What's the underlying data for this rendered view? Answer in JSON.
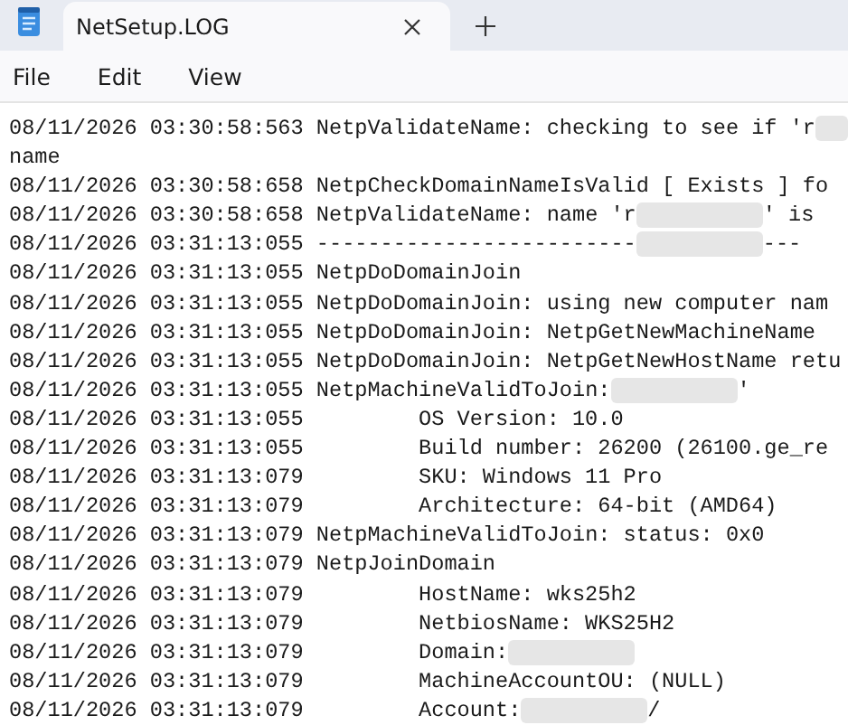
{
  "tabs": [
    {
      "label": "NetSetup.LOG",
      "selected": true
    }
  ],
  "menu": [
    "File",
    "Edit",
    "View"
  ],
  "lines": [
    {
      "kind": "entry",
      "timestamp": "08/11/2026 03:30:58:563",
      "segments": [
        {
          "kind": "text",
          "text": "NetpValidateName: checking to see if 'r"
        },
        {
          "kind": "redacted"
        }
      ]
    },
    {
      "kind": "continuation",
      "segments": [
        {
          "kind": "text",
          "text": "name"
        }
      ]
    },
    {
      "kind": "entry",
      "timestamp": "08/11/2026 03:30:58:658",
      "segments": [
        {
          "kind": "text",
          "text": "NetpCheckDomainNameIsValid [ Exists ] fo"
        }
      ]
    },
    {
      "kind": "entry",
      "timestamp": "08/11/2026 03:30:58:658",
      "segments": [
        {
          "kind": "text",
          "text": "NetpValidateName: name 'r"
        },
        {
          "kind": "redacted"
        },
        {
          "kind": "text",
          "text": "' is"
        }
      ]
    },
    {
      "kind": "entry",
      "timestamp": "08/11/2026 03:31:13:055",
      "segments": [
        {
          "kind": "text",
          "text": "-------------------------"
        },
        {
          "kind": "redacted"
        },
        {
          "kind": "text",
          "text": "---"
        }
      ]
    },
    {
      "kind": "entry",
      "timestamp": "08/11/2026 03:31:13:055",
      "segments": [
        {
          "kind": "text",
          "text": "NetpDoDomainJoin"
        }
      ]
    },
    {
      "kind": "entry",
      "timestamp": "08/11/2026 03:31:13:055",
      "segments": [
        {
          "kind": "text",
          "text": "NetpDoDomainJoin: using new computer nam"
        }
      ]
    },
    {
      "kind": "entry",
      "timestamp": "08/11/2026 03:31:13:055",
      "segments": [
        {
          "kind": "text",
          "text": "NetpDoDomainJoin: NetpGetNewMachineName"
        }
      ]
    },
    {
      "kind": "entry",
      "timestamp": "08/11/2026 03:31:13:055",
      "segments": [
        {
          "kind": "text",
          "text": "NetpDoDomainJoin: NetpGetNewHostName retu"
        }
      ]
    },
    {
      "kind": "entry",
      "timestamp": "08/11/2026 03:31:13:055",
      "segments": [
        {
          "kind": "text",
          "text": "NetpMachineValidToJoin:"
        },
        {
          "kind": "redacted"
        },
        {
          "kind": "text",
          "text": "'"
        }
      ]
    },
    {
      "kind": "detail",
      "timestamp": "08/11/2026 03:31:13:055",
      "segments": [
        {
          "kind": "text",
          "text": "OS Version: 10.0"
        }
      ]
    },
    {
      "kind": "detail",
      "timestamp": "08/11/2026 03:31:13:055",
      "segments": [
        {
          "kind": "text",
          "text": "Build number: 26200 (26100.ge_re"
        }
      ]
    },
    {
      "kind": "detail",
      "timestamp": "08/11/2026 03:31:13:079",
      "segments": [
        {
          "kind": "text",
          "text": "SKU: Windows 11 Pro"
        }
      ]
    },
    {
      "kind": "detail",
      "timestamp": "08/11/2026 03:31:13:079",
      "segments": [
        {
          "kind": "text",
          "text": "Architecture: 64-bit (AMD64)"
        }
      ]
    },
    {
      "kind": "entry",
      "timestamp": "08/11/2026 03:31:13:079",
      "segments": [
        {
          "kind": "text",
          "text": "NetpMachineValidToJoin: status: 0x0"
        }
      ]
    },
    {
      "kind": "entry",
      "timestamp": "08/11/2026 03:31:13:079",
      "segments": [
        {
          "kind": "text",
          "text": "NetpJoinDomain"
        }
      ]
    },
    {
      "kind": "detail",
      "timestamp": "08/11/2026 03:31:13:079",
      "segments": [
        {
          "kind": "text",
          "text": "HostName: wks25h2"
        }
      ]
    },
    {
      "kind": "detail",
      "timestamp": "08/11/2026 03:31:13:079",
      "segments": [
        {
          "kind": "text",
          "text": "NetbiosName: WKS25H2"
        }
      ]
    },
    {
      "kind": "detail",
      "timestamp": "08/11/2026 03:31:13:079",
      "segments": [
        {
          "kind": "text",
          "text": "Domain:"
        },
        {
          "kind": "redacted"
        }
      ]
    },
    {
      "kind": "detail",
      "timestamp": "08/11/2026 03:31:13:079",
      "segments": [
        {
          "kind": "text",
          "text": "MachineAccountOU: (NULL)"
        }
      ]
    },
    {
      "kind": "detail",
      "timestamp": "08/11/2026 03:31:13:079",
      "segments": [
        {
          "kind": "text",
          "text": "Account:"
        },
        {
          "kind": "redacted"
        },
        {
          "kind": "text",
          "text": "/"
        }
      ]
    }
  ]
}
